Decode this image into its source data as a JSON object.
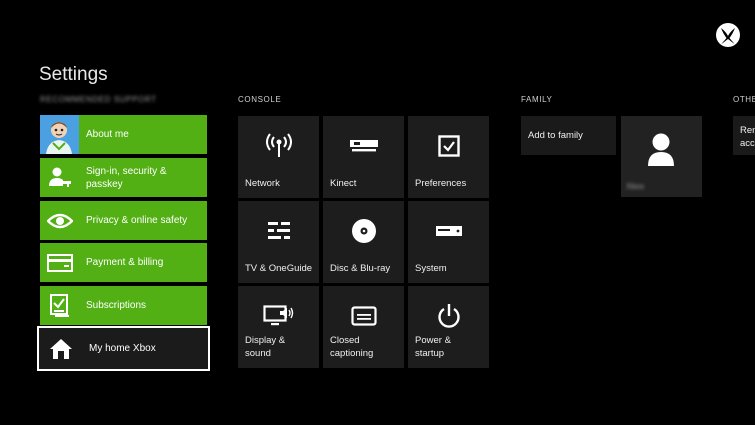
{
  "header": {
    "title": "Settings"
  },
  "sections": {
    "left_label": "RECOMMENDED SUPPORT",
    "console": "CONSOLE",
    "family": "FAMILY",
    "other": "OTHE"
  },
  "menu": [
    {
      "label": "About me",
      "icon": "avatar-icon"
    },
    {
      "label": "Sign-in, security & passkey",
      "icon": "user-key-icon"
    },
    {
      "label": "Privacy & online safety",
      "icon": "eye-icon"
    },
    {
      "label": "Payment & billing",
      "icon": "credit-card-icon"
    },
    {
      "label": "Subscriptions",
      "icon": "subscription-icon"
    },
    {
      "label": "My home Xbox",
      "icon": "home-icon",
      "selected": true
    }
  ],
  "console_tiles": [
    {
      "label": "Network",
      "icon": "network-icon"
    },
    {
      "label": "Kinect",
      "icon": "kinect-icon"
    },
    {
      "label": "Preferences",
      "icon": "checkbox-icon"
    },
    {
      "label": "TV & OneGuide",
      "icon": "tv-guide-icon"
    },
    {
      "label": "Disc & Blu-ray",
      "icon": "disc-icon"
    },
    {
      "label": "System",
      "icon": "console-icon"
    },
    {
      "label": "Display & sound",
      "icon": "display-sound-icon"
    },
    {
      "label": "Closed captioning",
      "icon": "captions-icon"
    },
    {
      "label": "Power & startup",
      "icon": "power-icon"
    }
  ],
  "family": {
    "add_label": "Add to family",
    "member_name": "Xbox"
  },
  "other": {
    "partial_label": "Rem acc"
  },
  "colors": {
    "accent": "#52b014",
    "tile": "#1d1d1d",
    "background": "#000000"
  }
}
